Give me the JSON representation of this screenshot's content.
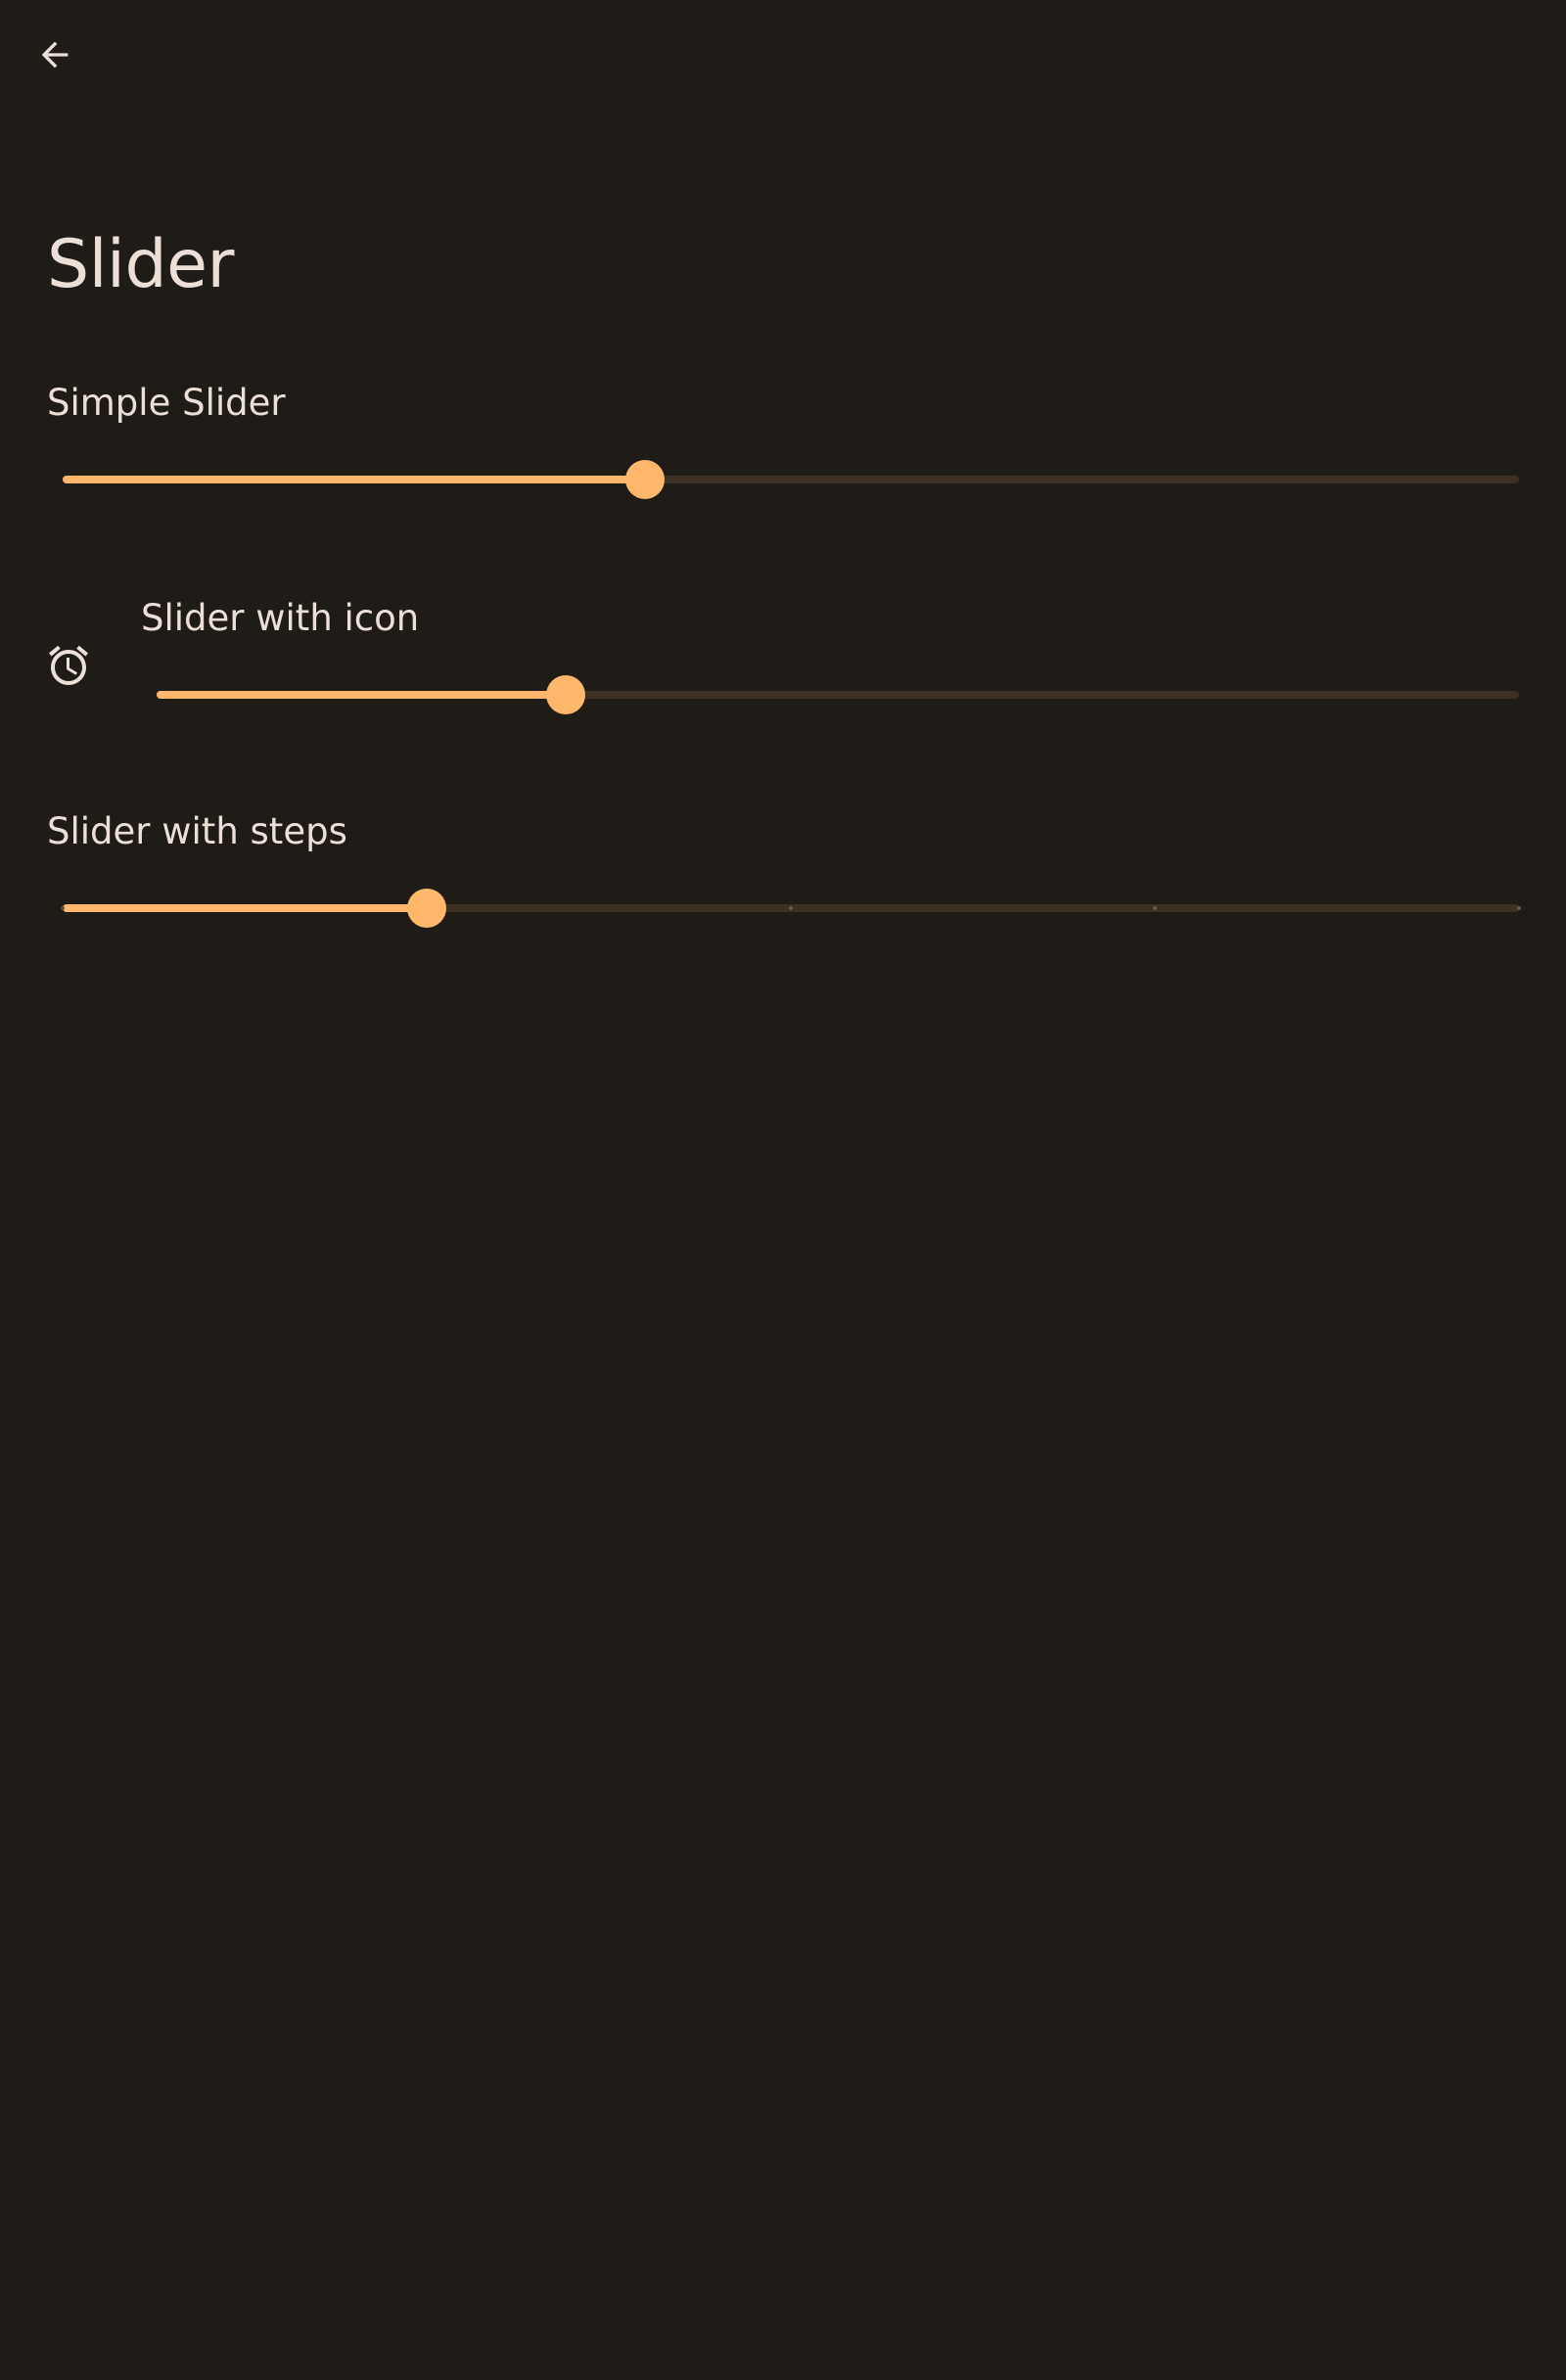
{
  "app": {
    "title": "Slider",
    "back_icon": "arrow-back-icon"
  },
  "colors": {
    "background": "#1f1b17",
    "accent": "#ffb86b",
    "track_inactive": "#3c3023",
    "text": "#ece0d6"
  },
  "sliders": [
    {
      "label": "Simple Slider",
      "value": 0.4,
      "icon": null
    },
    {
      "label": "Slider with icon",
      "value": 0.3,
      "icon": "alarm-clock-icon"
    },
    {
      "label": "Slider with steps",
      "value": 0.25,
      "steps": 4,
      "icon": null
    }
  ]
}
